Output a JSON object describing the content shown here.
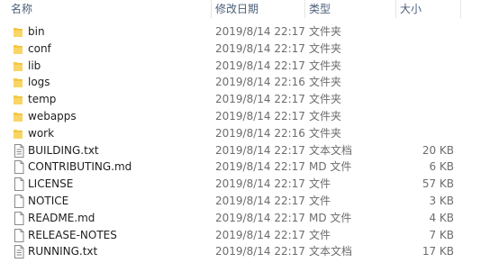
{
  "header": {
    "name_label": "名称",
    "date_label": "修改日期",
    "type_label": "类型",
    "size_label": "大小",
    "sort_indicator": "^"
  },
  "colors": {
    "folder_yellow": "#f5c843",
    "header_text": "#4c607a",
    "secondary_text": "#6d6d6d"
  },
  "files": [
    {
      "name": "bin",
      "date": "2019/8/14 22:17",
      "type": "文件夹",
      "size": "",
      "icon": "folder-icon"
    },
    {
      "name": "conf",
      "date": "2019/8/14 22:17",
      "type": "文件夹",
      "size": "",
      "icon": "folder-icon"
    },
    {
      "name": "lib",
      "date": "2019/8/14 22:17",
      "type": "文件夹",
      "size": "",
      "icon": "folder-icon"
    },
    {
      "name": "logs",
      "date": "2019/8/14 22:16",
      "type": "文件夹",
      "size": "",
      "icon": "folder-icon"
    },
    {
      "name": "temp",
      "date": "2019/8/14 22:17",
      "type": "文件夹",
      "size": "",
      "icon": "folder-icon"
    },
    {
      "name": "webapps",
      "date": "2019/8/14 22:17",
      "type": "文件夹",
      "size": "",
      "icon": "folder-icon"
    },
    {
      "name": "work",
      "date": "2019/8/14 22:16",
      "type": "文件夹",
      "size": "",
      "icon": "folder-icon"
    },
    {
      "name": "BUILDING.txt",
      "date": "2019/8/14 22:17",
      "type": "文本文档",
      "size": "20 KB",
      "icon": "text-file-icon"
    },
    {
      "name": "CONTRIBUTING.md",
      "date": "2019/8/14 22:17",
      "type": "MD 文件",
      "size": "6 KB",
      "icon": "file-icon"
    },
    {
      "name": "LICENSE",
      "date": "2019/8/14 22:17",
      "type": "文件",
      "size": "57 KB",
      "icon": "file-icon"
    },
    {
      "name": "NOTICE",
      "date": "2019/8/14 22:17",
      "type": "文件",
      "size": "3 KB",
      "icon": "file-icon"
    },
    {
      "name": "README.md",
      "date": "2019/8/14 22:17",
      "type": "MD 文件",
      "size": "4 KB",
      "icon": "file-icon"
    },
    {
      "name": "RELEASE-NOTES",
      "date": "2019/8/14 22:17",
      "type": "文件",
      "size": "7 KB",
      "icon": "file-icon"
    },
    {
      "name": "RUNNING.txt",
      "date": "2019/8/14 22:17",
      "type": "文本文档",
      "size": "17 KB",
      "icon": "text-file-icon"
    }
  ]
}
